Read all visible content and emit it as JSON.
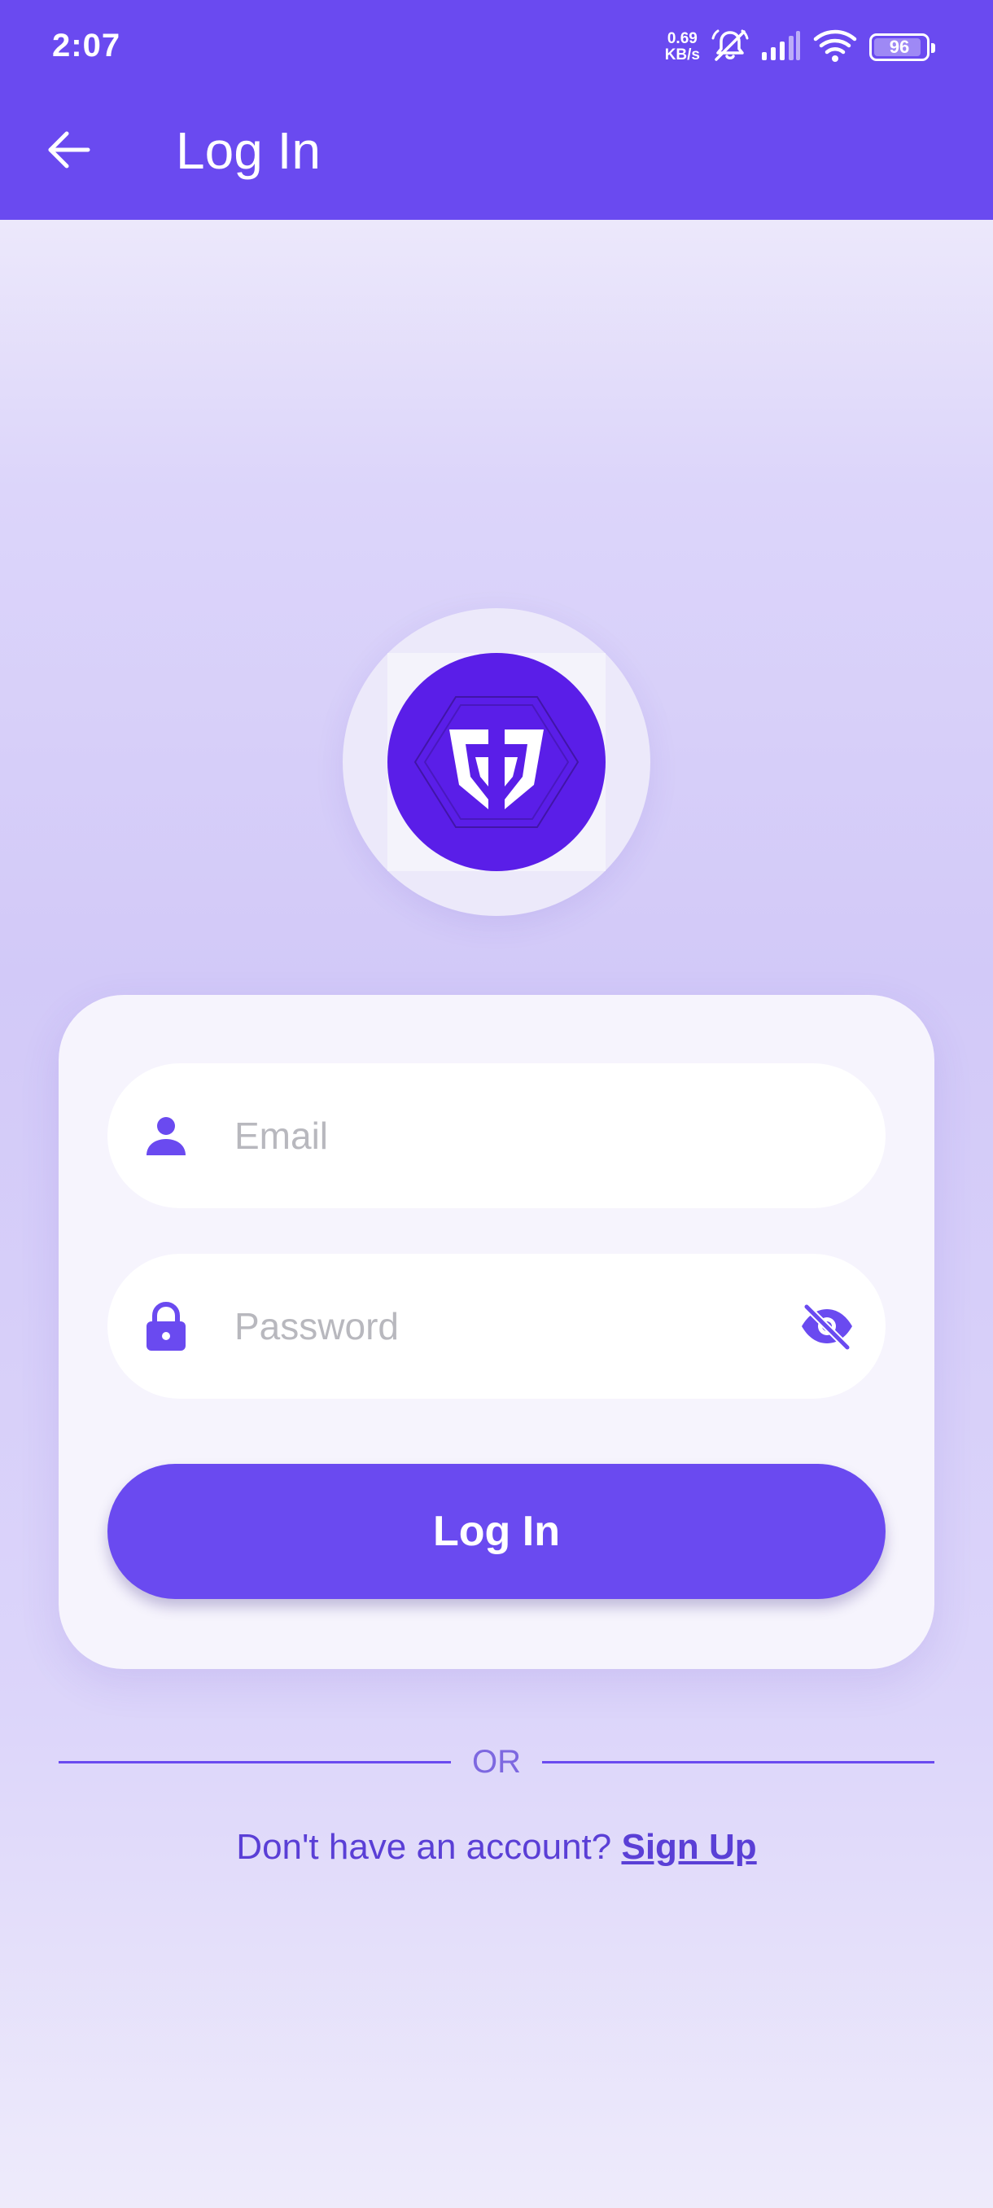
{
  "status_bar": {
    "time": "2:07",
    "net_speed_value": "0.69",
    "net_speed_unit": "KB/s",
    "battery_level": "96",
    "icons": [
      "mute-alarm-icon",
      "signal-icon",
      "wifi-icon",
      "battery-icon"
    ]
  },
  "app_bar": {
    "title": "Log In",
    "back_icon": "arrow-left-icon"
  },
  "logo": {
    "icon": "brand-logo-icon"
  },
  "form": {
    "email": {
      "placeholder": "Email",
      "value": "",
      "icon": "person-icon"
    },
    "password": {
      "placeholder": "Password",
      "value": "",
      "icon": "lock-icon",
      "toggle_icon": "eye-off-icon"
    },
    "submit_label": "Log In"
  },
  "divider_text": "OR",
  "signup": {
    "prompt": "Don't have an account?",
    "link_label": "Sign Up"
  },
  "colors": {
    "primary": "#6a4af0",
    "logo_background": "#5a1ee8",
    "card_background": "#f6f4fd",
    "page_background": "#dcd5fa"
  }
}
